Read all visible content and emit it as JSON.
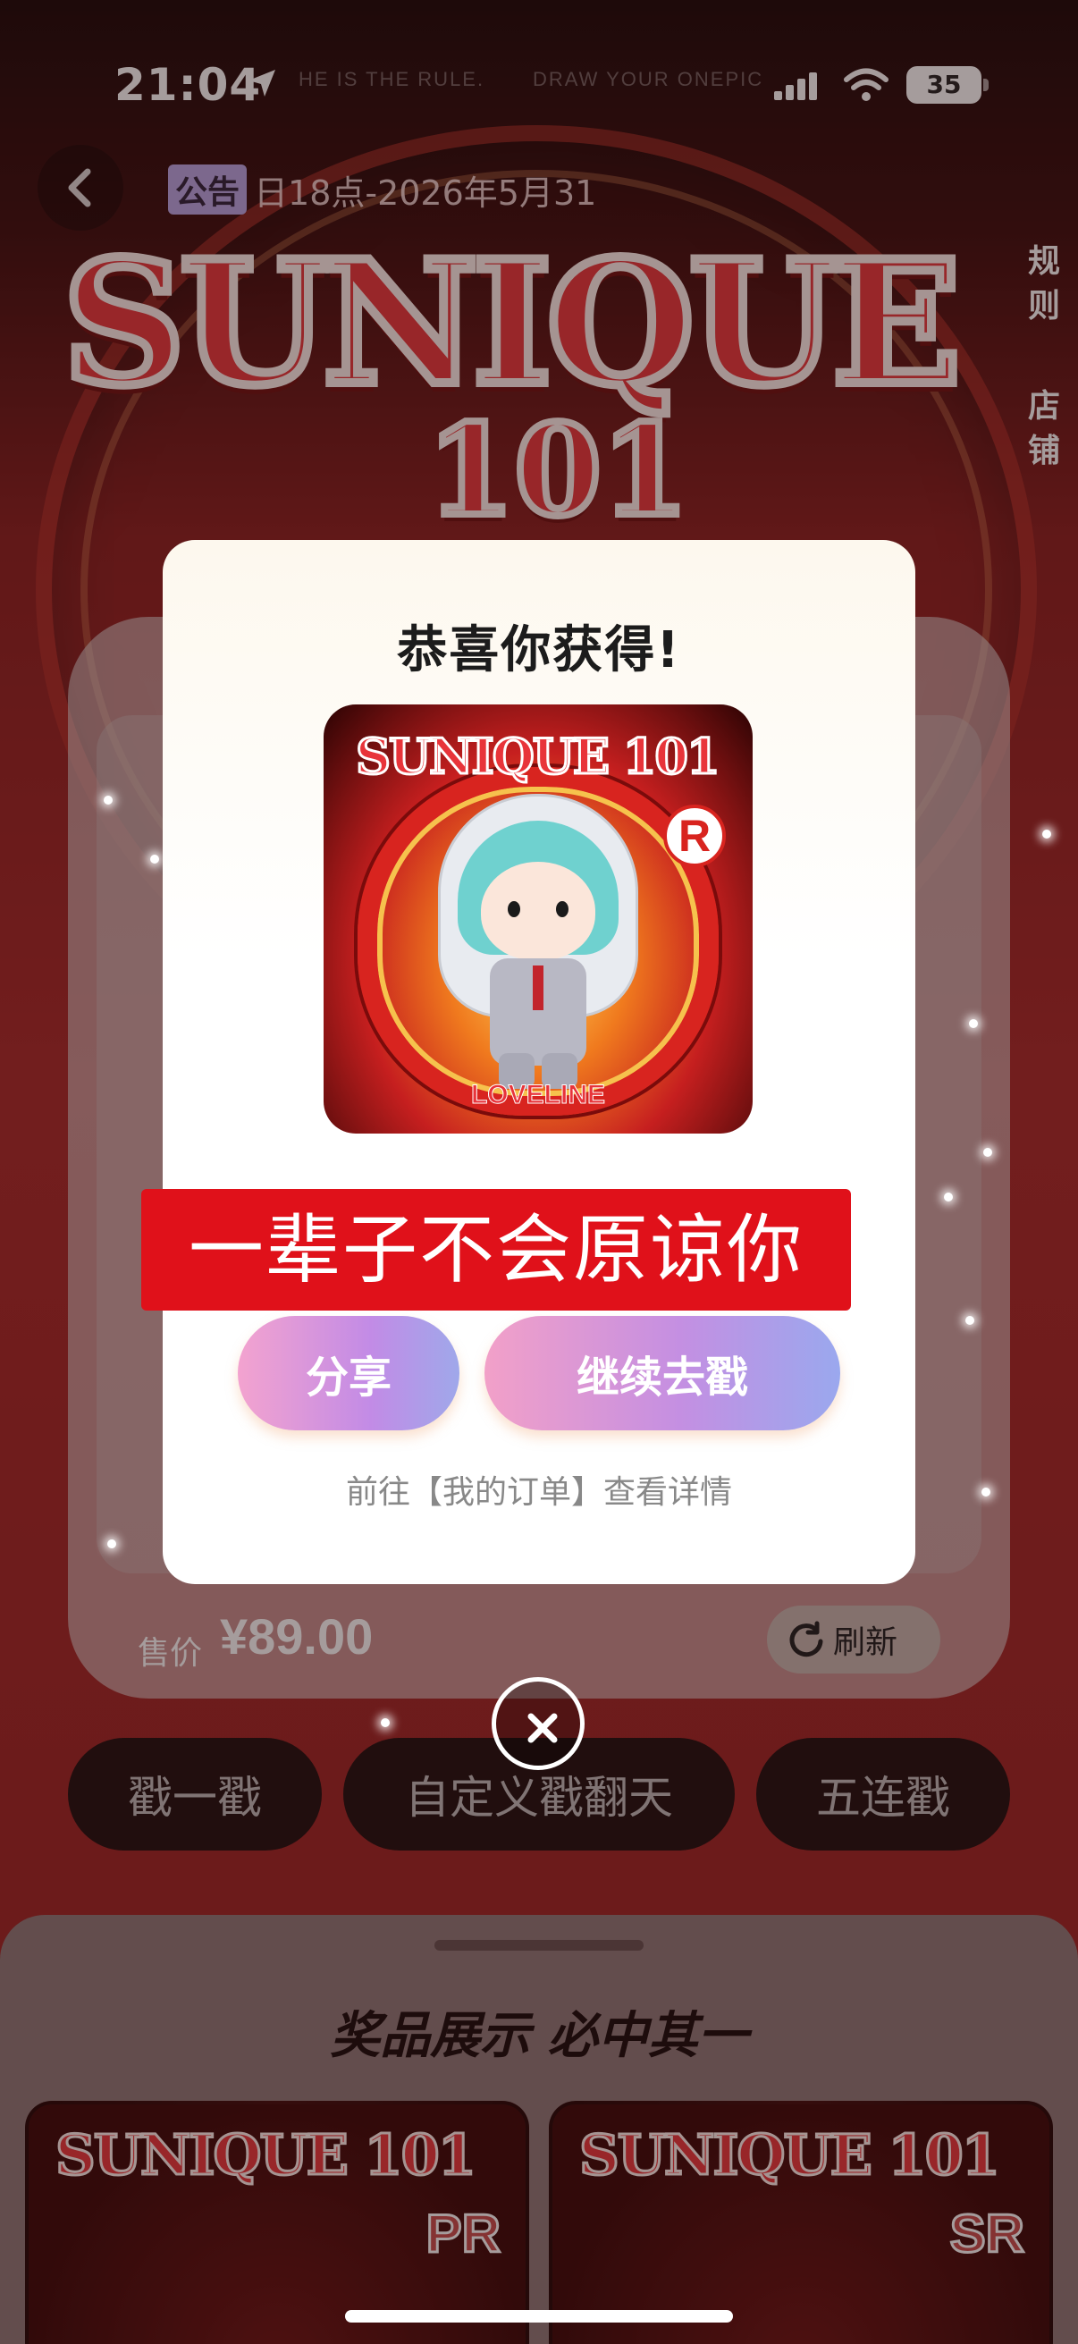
{
  "status_bar": {
    "time": "21:04",
    "marquee_left": "HE IS THE RULE.",
    "marquee_right": "DRAW YOUR ONEPIC",
    "battery": "35"
  },
  "header": {
    "notice_tag": "公告",
    "notice_text": "日18点-2026年5月31",
    "logo_text": "SUNIQUE",
    "logo_number": "101",
    "side_links": [
      "规则",
      "店铺"
    ]
  },
  "machine": {
    "price_label": "售价",
    "price_value": "¥89.00",
    "refresh_label": "刷新"
  },
  "actions": [
    "戳一戳",
    "自定义戳翻天",
    "五连戳"
  ],
  "prize_panel": {
    "title": "奖品展示 必中其一",
    "cards": [
      {
        "logo": "SUNIQUE 101",
        "rarity": "PR"
      },
      {
        "logo": "SUNIQUE 101",
        "rarity": "SR"
      }
    ]
  },
  "dialog": {
    "title": "恭喜你获得!",
    "prize_image": {
      "logo": "SUNIQUE 101",
      "rarity": "R",
      "caption": "LOVELINE"
    },
    "banner": "一辈子不会原谅你",
    "share_label": "分享",
    "continue_label": "继续去戳",
    "hint": "前往【我的订单】查看详情"
  },
  "colors": {
    "accent_red": "#e0111a",
    "button_gradient_start": "#f3a3cf",
    "button_gradient_end": "#9aa8ee"
  },
  "icons": {
    "back": "chevron-left-icon",
    "location": "location-arrow-icon",
    "refresh": "refresh-icon",
    "close": "close-icon"
  }
}
